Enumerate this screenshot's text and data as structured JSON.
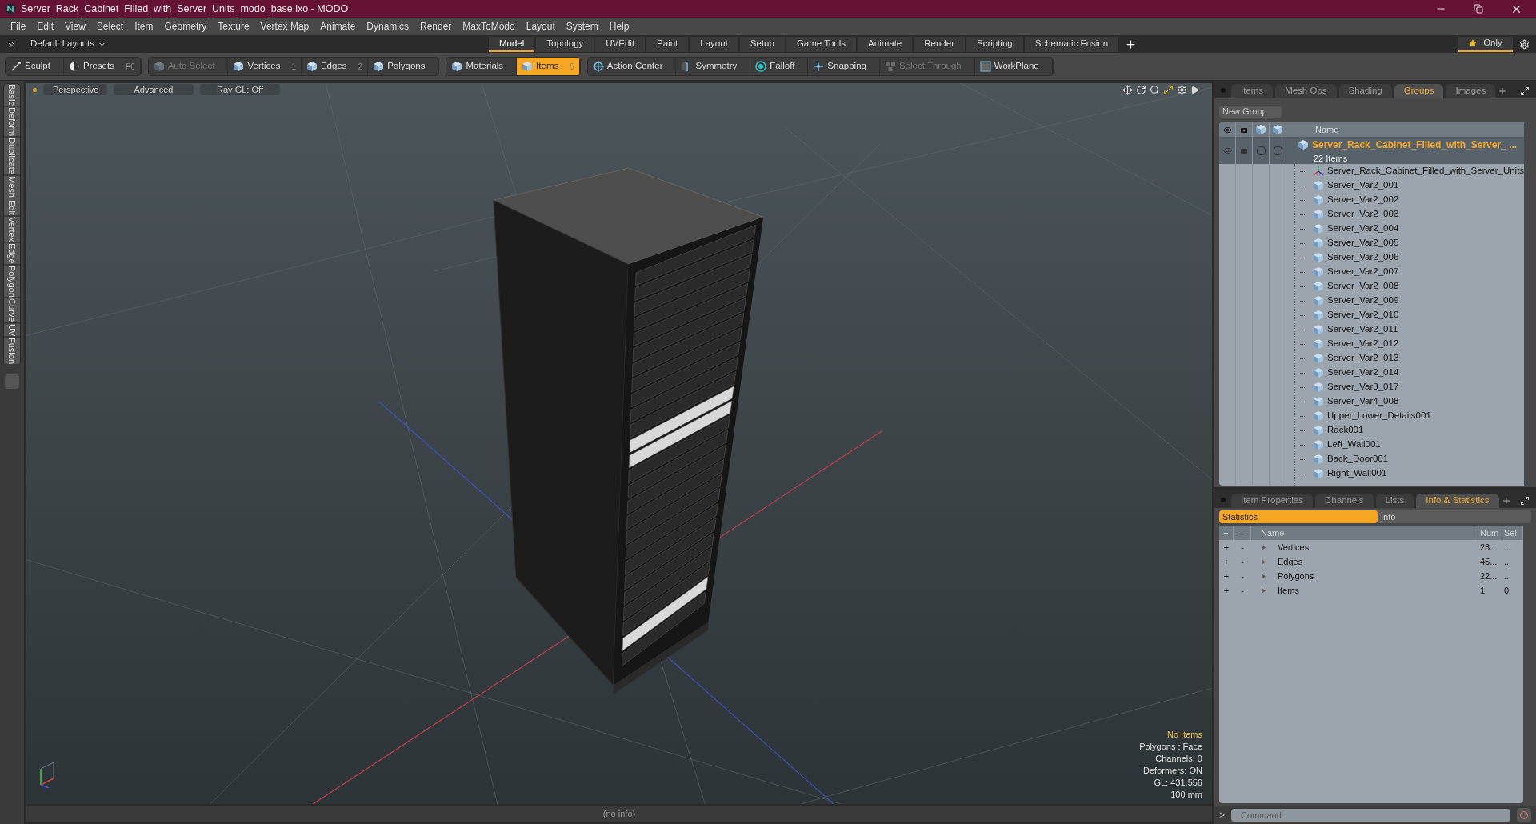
{
  "window": {
    "title": "Server_Rack_Cabinet_Filled_with_Server_Units_modo_base.lxo - MODO"
  },
  "menu": [
    "File",
    "Edit",
    "View",
    "Select",
    "Item",
    "Geometry",
    "Texture",
    "Vertex Map",
    "Animate",
    "Dynamics",
    "Render",
    "MaxToModo",
    "Layout",
    "System",
    "Help"
  ],
  "layout_bar": {
    "layout_menu": "Default Layouts",
    "tabs": [
      {
        "label": "Model",
        "selected": true
      },
      {
        "label": "Topology",
        "selected": false
      },
      {
        "label": "UVEdit",
        "selected": false
      },
      {
        "label": "Paint",
        "selected": false
      },
      {
        "label": "Layout",
        "selected": false
      },
      {
        "label": "Setup",
        "selected": false
      },
      {
        "label": "Game Tools",
        "selected": false
      },
      {
        "label": "Animate",
        "selected": false
      },
      {
        "label": "Render",
        "selected": false
      },
      {
        "label": "Scripting",
        "selected": false
      },
      {
        "label": "Schematic Fusion",
        "selected": false
      }
    ],
    "only_button": "Only"
  },
  "toolbar": [
    [
      {
        "label": "Sculpt",
        "kind": "brush",
        "selected": false,
        "disabled": false
      },
      {
        "label": "Presets",
        "shortcut": "F6",
        "kind": "presets",
        "selected": false,
        "disabled": false
      }
    ],
    [
      {
        "label": "Auto Select",
        "kind": "cube",
        "selected": false,
        "disabled": true
      },
      {
        "label": "Vertices",
        "shortcut": "1",
        "kind": "cube",
        "selected": false,
        "disabled": false
      },
      {
        "label": "Edges",
        "shortcut": "2",
        "kind": "cube",
        "selected": false,
        "disabled": false
      },
      {
        "label": "Polygons",
        "kind": "cube",
        "selected": false,
        "disabled": false
      }
    ],
    [
      {
        "label": "Materials",
        "kind": "cube",
        "selected": false,
        "disabled": false
      },
      {
        "label": "Items",
        "shortcut": "5",
        "kind": "cube",
        "selected": true,
        "disabled": false
      }
    ],
    [
      {
        "label": "Action Center",
        "kind": "target",
        "selected": false,
        "disabled": false
      },
      {
        "label": "Symmetry",
        "kind": "symmetry",
        "selected": false,
        "disabled": false
      },
      {
        "label": "Falloff",
        "kind": "falloff",
        "selected": false,
        "disabled": false
      },
      {
        "label": "Snapping",
        "kind": "snap",
        "selected": false,
        "disabled": false
      },
      {
        "label": "Select Through",
        "kind": "through",
        "selected": false,
        "disabled": true
      },
      {
        "label": "WorkPlane",
        "kind": "workplane",
        "selected": false,
        "disabled": false
      }
    ]
  ],
  "left_tabs": [
    "Basic",
    "Deform",
    "Duplicate",
    "Mesh Edit",
    "Vertex",
    "Edge",
    "Polygon",
    "Curve",
    "UV",
    "Fusion"
  ],
  "viewport": {
    "buttons": [
      "Perspective",
      "Advanced",
      "Ray GL: Off"
    ],
    "info": [
      {
        "text": "No Items",
        "kind": "highlight"
      },
      {
        "text": "Polygons : Face",
        "kind": "normal"
      },
      {
        "text": "Channels: 0",
        "kind": "normal"
      },
      {
        "text": "Deformers: ON",
        "kind": "normal"
      },
      {
        "text": "GL: 431,556",
        "kind": "normal"
      },
      {
        "text": "100 mm",
        "kind": "normal"
      }
    ]
  },
  "groups_panel": {
    "tabs": [
      {
        "label": "Items",
        "selected": false
      },
      {
        "label": "Mesh Ops",
        "selected": false
      },
      {
        "label": "Shading",
        "selected": false
      },
      {
        "label": "Groups",
        "selected": true
      },
      {
        "label": "Images",
        "selected": false
      }
    ],
    "new_group_button": "New Group",
    "name_column": "Name",
    "group": {
      "name": "Server_Rack_Cabinet_Filled_with_Server_ ...",
      "count": "22 Items",
      "children": [
        {
          "name": "Server_Rack_Cabinet_Filled_with_Server_Units",
          "kind": "locator"
        },
        {
          "name": "Server_Var2_001",
          "kind": "mesh"
        },
        {
          "name": "Server_Var2_002",
          "kind": "mesh"
        },
        {
          "name": "Server_Var2_003",
          "kind": "mesh"
        },
        {
          "name": "Server_Var2_004",
          "kind": "mesh"
        },
        {
          "name": "Server_Var2_005",
          "kind": "mesh"
        },
        {
          "name": "Server_Var2_006",
          "kind": "mesh"
        },
        {
          "name": "Server_Var2_007",
          "kind": "mesh"
        },
        {
          "name": "Server_Var2_008",
          "kind": "mesh"
        },
        {
          "name": "Server_Var2_009",
          "kind": "mesh"
        },
        {
          "name": "Server_Var2_010",
          "kind": "mesh"
        },
        {
          "name": "Server_Var2_011",
          "kind": "mesh"
        },
        {
          "name": "Server_Var2_012",
          "kind": "mesh"
        },
        {
          "name": "Server_Var2_013",
          "kind": "mesh"
        },
        {
          "name": "Server_Var2_014",
          "kind": "mesh"
        },
        {
          "name": "Server_Var3_017",
          "kind": "mesh"
        },
        {
          "name": "Server_Var4_008",
          "kind": "mesh"
        },
        {
          "name": "Upper_Lower_Details001",
          "kind": "mesh"
        },
        {
          "name": "Rack001",
          "kind": "mesh"
        },
        {
          "name": "Left_Wall001",
          "kind": "mesh"
        },
        {
          "name": "Back_Door001",
          "kind": "mesh"
        },
        {
          "name": "Right_Wall001",
          "kind": "mesh"
        }
      ]
    }
  },
  "stats_panel": {
    "tabs": [
      {
        "label": "Item Properties",
        "selected": false
      },
      {
        "label": "Channels",
        "selected": false
      },
      {
        "label": "Lists",
        "selected": false
      },
      {
        "label": "Info & Statistics",
        "selected": true
      }
    ],
    "subtabs": [
      {
        "label": "Statistics",
        "selected": true
      },
      {
        "label": "Info",
        "selected": false
      }
    ],
    "columns": [
      "+",
      "-",
      "Name",
      "Num",
      "Sel"
    ],
    "rows": [
      {
        "add": "+",
        "remove": "-",
        "name": "Vertices",
        "num": "23...",
        "sel": "...",
        "expanded": false
      },
      {
        "add": "+",
        "remove": "-",
        "name": "Edges",
        "num": "45...",
        "sel": "...",
        "expanded": false
      },
      {
        "add": "+",
        "remove": "-",
        "name": "Polygons",
        "num": "22...",
        "sel": "...",
        "expanded": false
      },
      {
        "add": "+",
        "remove": "-",
        "name": "Items",
        "num": "1",
        "sel": "0",
        "expanded": false
      }
    ]
  },
  "status_bar": "(no info)",
  "command": {
    "prompt": ">",
    "placeholder": "Command"
  }
}
